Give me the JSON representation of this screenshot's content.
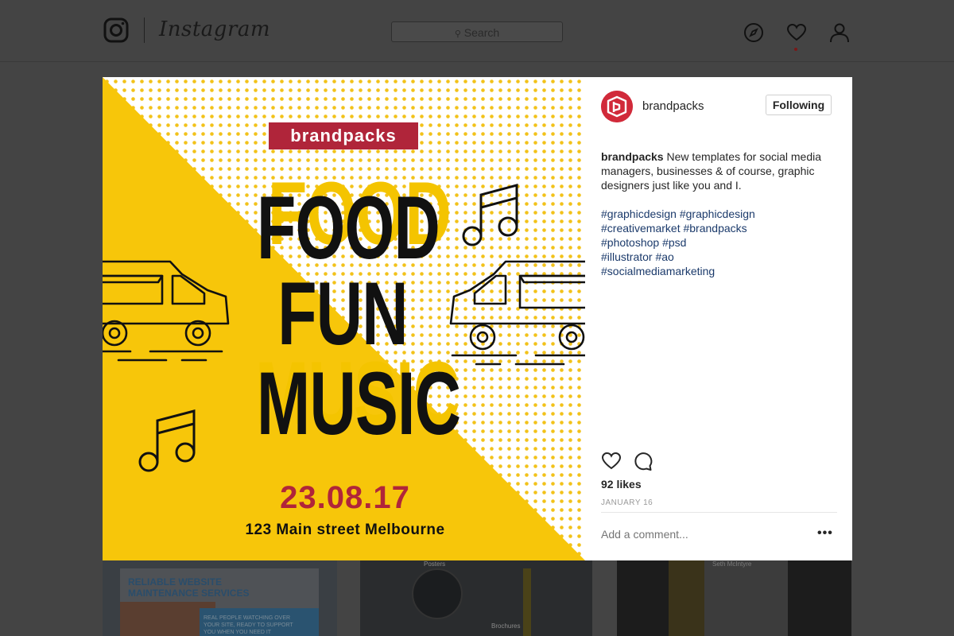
{
  "app": {
    "wordmark": "Instagram",
    "search_placeholder": "Search"
  },
  "nav_icons": [
    "compass-icon",
    "heart-icon",
    "profile-icon"
  ],
  "post": {
    "username": "brandpacks",
    "follow_label": "Following",
    "caption_user": "brandpacks",
    "caption_text": "New templates for social media managers, businesses & of course, graphic designers just like you and I.",
    "hashtags": [
      "#graphicdesign #graphicdesign",
      "#creativemarket #brandpacks",
      "#photoshop #psd",
      "#illustrator #ao",
      "#socialmediamarketing"
    ],
    "likes": "92 likes",
    "date": "JANUARY 16",
    "comment_placeholder": "Add a comment...",
    "more_label": "•••"
  },
  "poster": {
    "brand": "brandpacks",
    "headline": [
      "FOOD",
      "FUN",
      "MUSIC"
    ],
    "event_date": "23.08.17",
    "address": "123 Main street Melbourne"
  },
  "feed_tiles": {
    "tile1_title": [
      "RELIABLE WEBSITE",
      "MAINTENANCE SERVICES"
    ],
    "tile1_small": [
      "REAL PEOPLE WATCHING OVER",
      "YOUR SITE, READY TO SUPPORT",
      "YOU WHEN YOU NEED IT"
    ],
    "tile2_labels": [
      "Posters",
      "Brochures"
    ],
    "tile3_name": "Seth McIntyre"
  },
  "colors": {
    "poster_yellow": "#f7c60a",
    "poster_red": "#b0253a",
    "hashtag": "#1b3a6b",
    "avatar": "#d12a3a"
  }
}
